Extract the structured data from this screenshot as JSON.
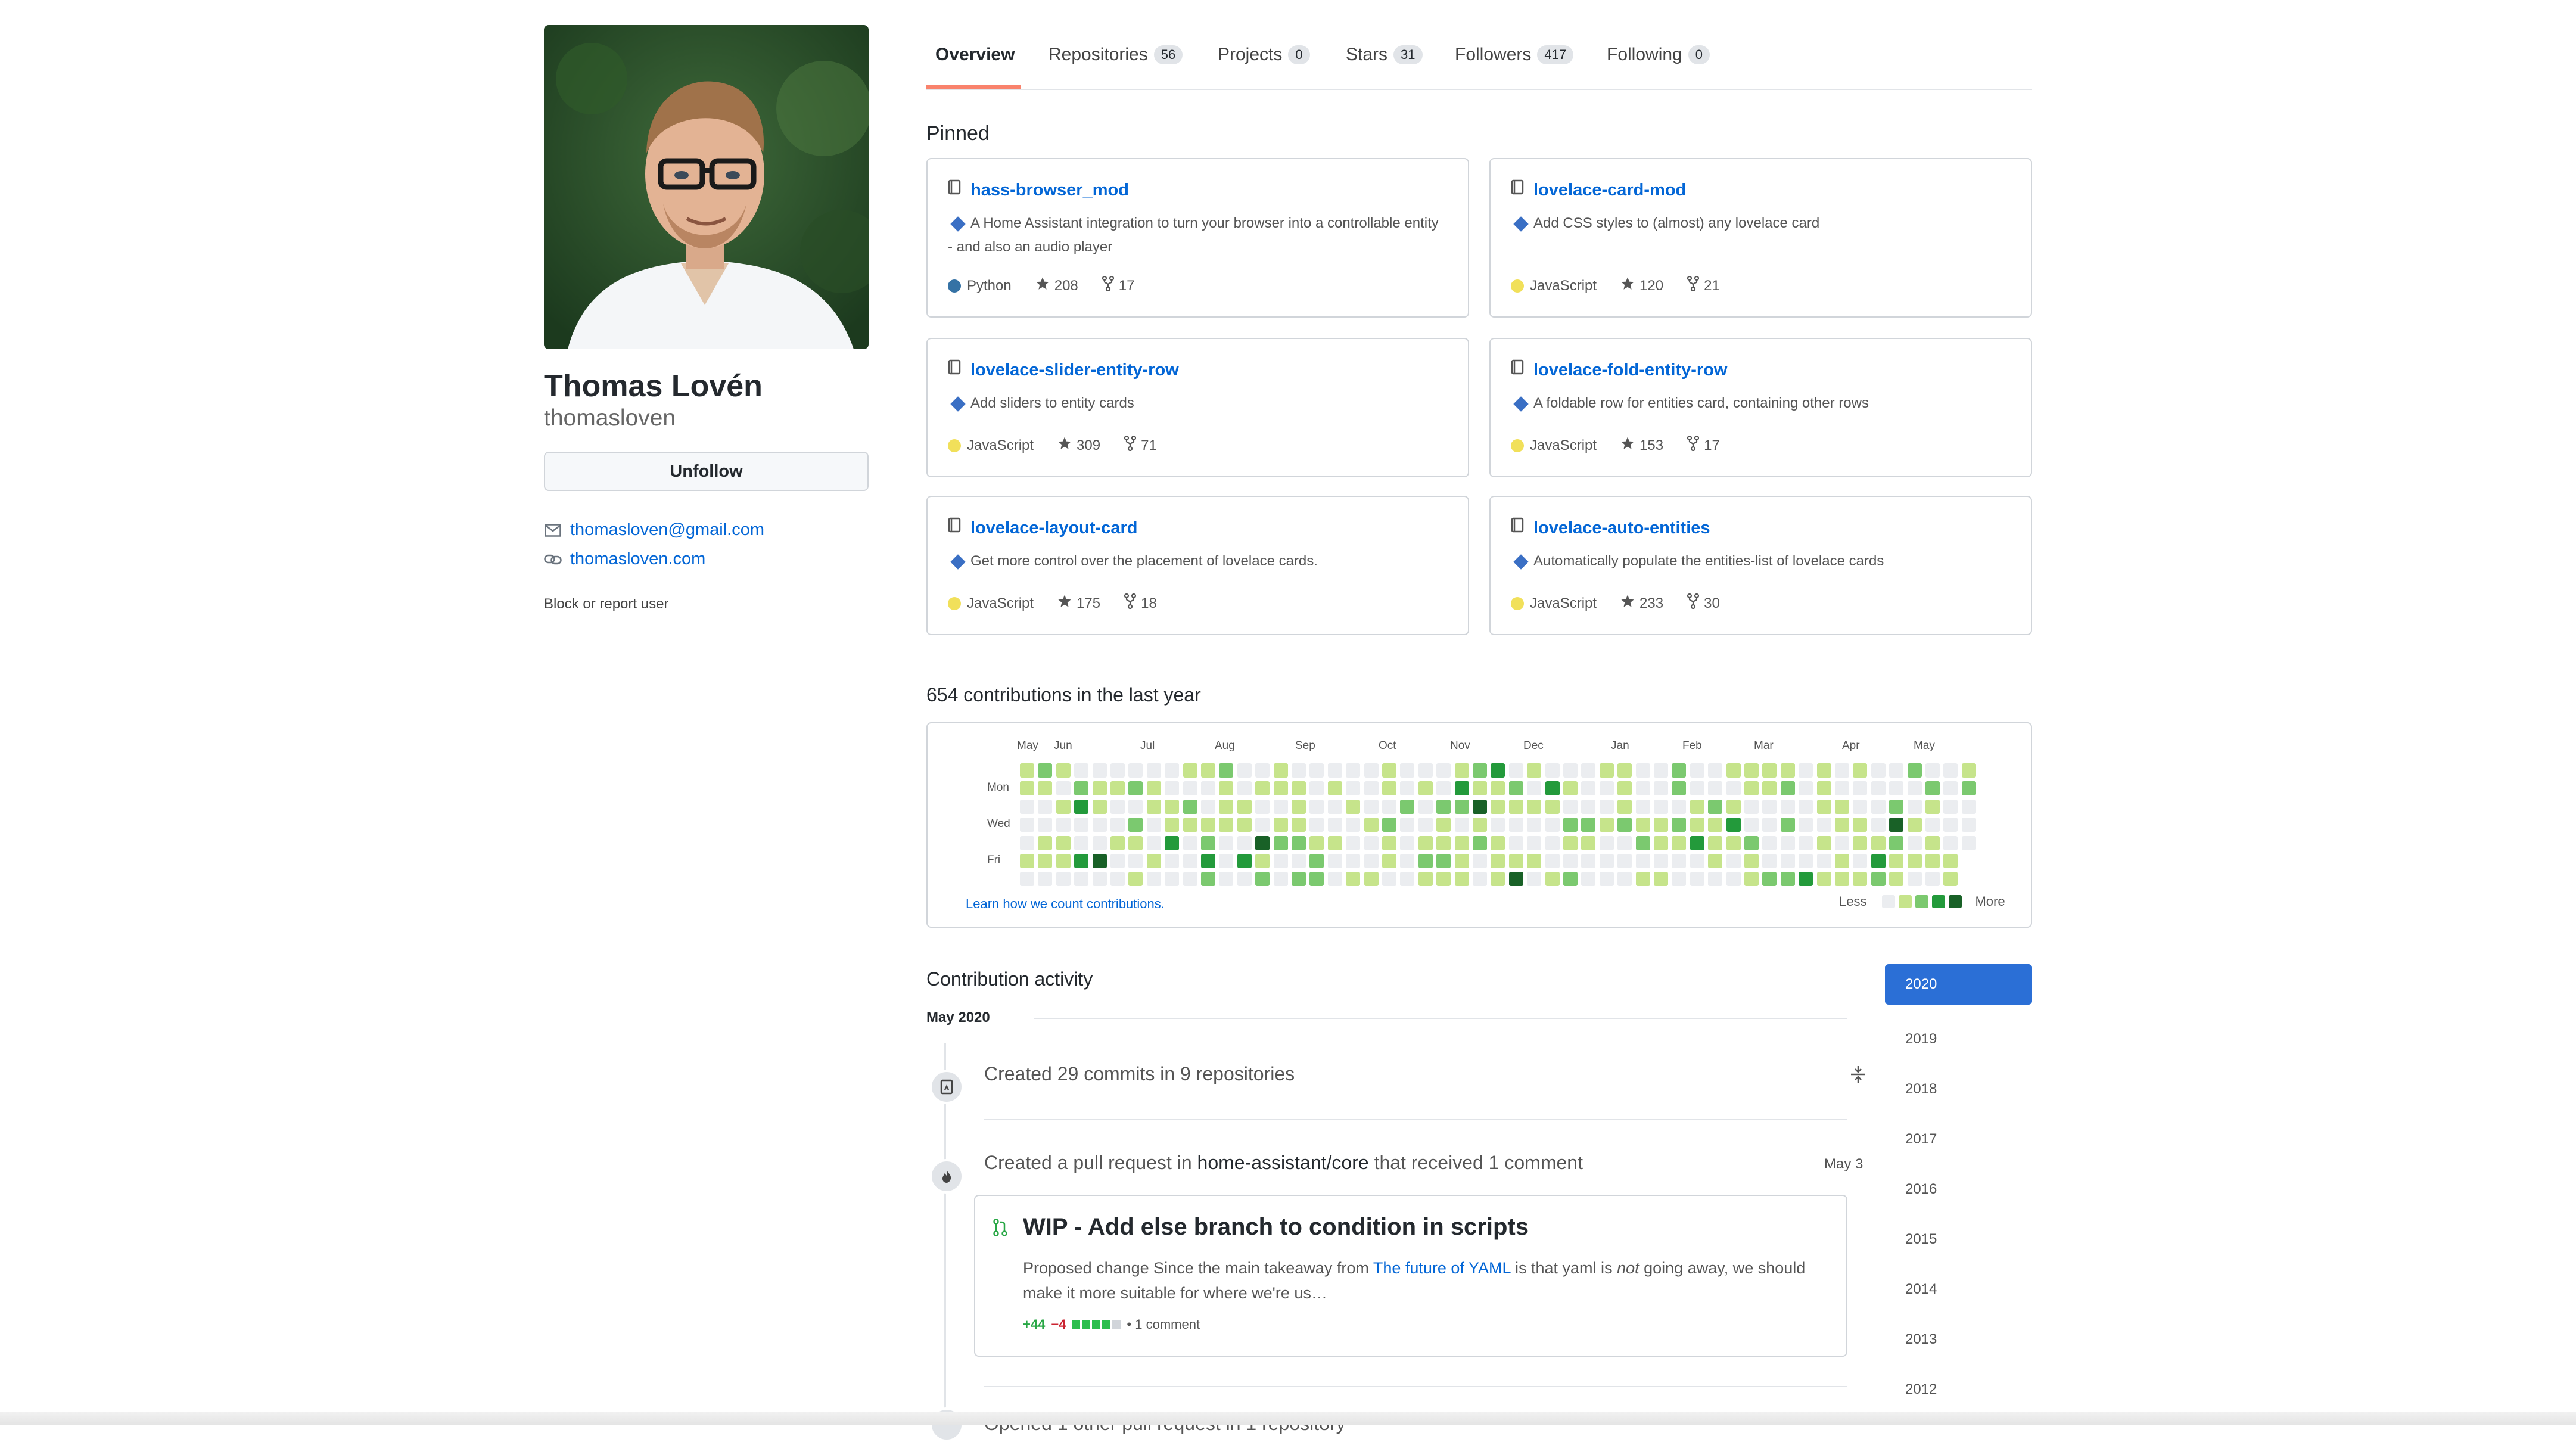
{
  "profile": {
    "full_name": "Thomas Lovén",
    "username": "thomasloven",
    "follow_button": "Unfollow",
    "email": "thomasloven@gmail.com",
    "website": "thomasloven.com",
    "block_link": "Block or report user"
  },
  "tabs": [
    {
      "label": "Overview",
      "count": ""
    },
    {
      "label": "Repositories",
      "count": "56"
    },
    {
      "label": "Projects",
      "count": "0"
    },
    {
      "label": "Stars",
      "count": "31"
    },
    {
      "label": "Followers",
      "count": "417"
    },
    {
      "label": "Following",
      "count": "0"
    }
  ],
  "pinned": {
    "title": "Pinned",
    "repos": [
      {
        "name": "hass-browser_mod",
        "description": "A Home Assistant integration to turn your browser into a controllable entity - and also an audio player",
        "language": "Python",
        "lang_color": "#3572A5",
        "stars": "208",
        "forks": "17"
      },
      {
        "name": "lovelace-card-mod",
        "description": "Add CSS styles to (almost) any lovelace card",
        "language": "JavaScript",
        "lang_color": "#f1e05a",
        "stars": "120",
        "forks": "21"
      },
      {
        "name": "lovelace-slider-entity-row",
        "description": "Add sliders to entity cards",
        "language": "JavaScript",
        "lang_color": "#f1e05a",
        "stars": "309",
        "forks": "71"
      },
      {
        "name": "lovelace-fold-entity-row",
        "description": "A foldable row for entities card, containing other rows",
        "language": "JavaScript",
        "lang_color": "#f1e05a",
        "stars": "153",
        "forks": "17"
      },
      {
        "name": "lovelace-layout-card",
        "description": "Get more control over the placement of lovelace cards.",
        "language": "JavaScript",
        "lang_color": "#f1e05a",
        "stars": "175",
        "forks": "18"
      },
      {
        "name": "lovelace-auto-entities",
        "description": "Automatically populate the entities-list of lovelace cards",
        "language": "JavaScript",
        "lang_color": "#f1e05a",
        "stars": "233",
        "forks": "30"
      }
    ]
  },
  "contributions": {
    "title": "654 contributions in the last year",
    "months": [
      "May",
      "Jun",
      "Jul",
      "Aug",
      "Sep",
      "Oct",
      "Nov",
      "Dec",
      "Jan",
      "Feb",
      "Mar",
      "Apr",
      "May"
    ],
    "days": [
      "Mon",
      "Wed",
      "Fri"
    ],
    "learn_link": "Learn how we count contributions.",
    "legend_less": "Less",
    "legend_more": "More",
    "level_colors": [
      "#ebedf0",
      "#c6e48b",
      "#7bc96f",
      "#239a3b",
      "#196127"
    ]
  },
  "activity": {
    "title": "Contribution activity",
    "month_label": "May 2020",
    "commits_text": "Created 29 commits in 9 repositories",
    "pr_prefix": "Created a pull request in",
    "pr_repo": "home-assistant/core",
    "pr_suffix": "that received 1 comment",
    "pr_date": "May 3",
    "pr_title": "WIP - Add else branch to condition in scripts",
    "pr_body_1": "Proposed change Since the main takeaway from",
    "pr_body_link": "The future of YAML",
    "pr_body_2": "is that yaml is",
    "pr_body_em": "not",
    "pr_body_3": "going away, we should make it more suitable for where we're us…",
    "pr_additions": "+44",
    "pr_deletions": "−4",
    "pr_comments": "• 1 comment",
    "next_text": "Opened 1 other pull request in 1 repository"
  },
  "years": [
    "2020",
    "2019",
    "2018",
    "2017",
    "2016",
    "2015",
    "2014",
    "2013",
    "2012"
  ]
}
